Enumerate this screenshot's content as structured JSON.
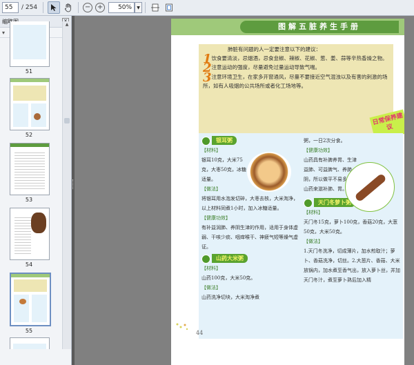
{
  "toolbar": {
    "page_current": "55",
    "page_total": "/ 254",
    "zoom": "50%",
    "icons": [
      "select-cursor-icon",
      "hand-tool-icon",
      "zoom-out-icon",
      "zoom-in-icon",
      "zoom-dropdown-icon",
      "fit-width-icon",
      "fit-page-icon"
    ]
  },
  "panel": {
    "title": "缩略图",
    "thumbnails": [
      {
        "label": "51"
      },
      {
        "label": "52"
      },
      {
        "label": "53"
      },
      {
        "label": "54"
      },
      {
        "label": "55"
      }
    ]
  },
  "document": {
    "banner": "图解五脏养生手册",
    "intro_heading": "肺脏有问题的人一定要注意以下的建议：",
    "advice": [
      {
        "num": "1",
        "text": "饮食要清淡，忌烟酒，忌食韭椒、辣椒、花椒、葱、姜、蒜等辛热香燥之物。"
      },
      {
        "num": "2",
        "text": "注意运动的强度，尽量避免过量运动导致气喘。"
      },
      {
        "num": "3",
        "text": "注意环境卫生，在家多开窗通风，尽量不要接近空气混浊以及有害的刺激的场所，如有人吸烟的公共场所或者化工场地等。"
      }
    ],
    "tag": "日常保养建议",
    "dish1": {
      "title": "银耳粥",
      "ingredients_label": "【材料】",
      "ingredients": "银耳10克，大米75克，大枣50克，冰糖适量。",
      "method_label": "【做法】",
      "method": "将银耳用水泡发切碎，大枣去核，大米淘净，以上材料同煮1小时，加入冰糖适量。",
      "benefit_label": "【健康功效】",
      "benefit": "有补益润肺、养阴生津的作用，适用于身体虚弱、干咳少痰、咽痒喉干、神疲气短等燥气虚证。"
    },
    "dish2": {
      "title": "山药大米粥",
      "ingredients_label": "【材料】",
      "ingredients": "山药100克，大米50克。",
      "method_label": "【做法】",
      "method": "山药洗净切块，大米淘净煮"
    },
    "right_col": {
      "cont": "粥，一日2次分食。",
      "benefit_label": "【健康功效】",
      "benefit": "山药具有补脾养胃、生津益肺、可益脾气、养肺阴，所以做平不易多吃些山药来滋补肺、胃。",
      "dish3_title": "天门冬萝卜粥",
      "ingredients_label": "【材料】",
      "ingredients": "天门冬15克，萝卜100克，香菇20克，大葱50克，大米50克。",
      "method_label": "【做法】",
      "method": "1.天门冬洗净，切成薄片，加水煎取汁；萝卜、香菇洗净，切丝。2.大葱片、香菇、大米放锅内，加水煮至香气出，放入萝卜丝，并加天门冬汁，煮至萝卜熟后加入精"
    },
    "page_number": "44"
  }
}
